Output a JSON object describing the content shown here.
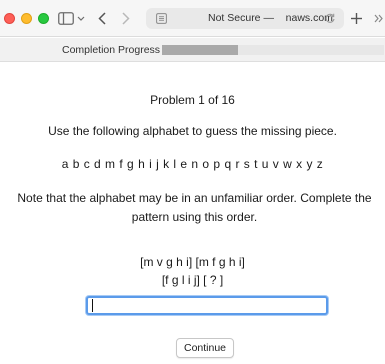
{
  "browser": {
    "address": {
      "prefix": "Not Secure — ",
      "faded": "   ",
      "domain": "naws.com"
    },
    "icons": {
      "sidebar": "sidebar-icon",
      "chevron": "chevron-down-icon",
      "back": "back-arrow-icon",
      "forward": "forward-arrow-icon",
      "reader": "reader-icon",
      "reload": "reload-icon",
      "new_tab": "plus-icon",
      "more": "more-icon"
    },
    "colors": {
      "close": "#fe5f57",
      "minimize": "#febc2e",
      "zoom": "#28c840"
    }
  },
  "progress": {
    "label": "Completion Progress",
    "fraction": 0.0625
  },
  "problem": {
    "title": "Problem 1 of 16",
    "instruction": "Use the following alphabet to guess the missing piece.",
    "alphabet": "a b c d m f g h i j k l e n o p q r s t u v w x y z",
    "note": "Note that the alphabet may be in an unfamiliar order. Complete the pattern using this order.",
    "pattern_line1": "[m v g h i]  [m f g h i]",
    "pattern_line2": "[f g l i j]  [ ? ]"
  },
  "answer": {
    "value": "",
    "placeholder": ""
  },
  "continue_label": "Continue"
}
